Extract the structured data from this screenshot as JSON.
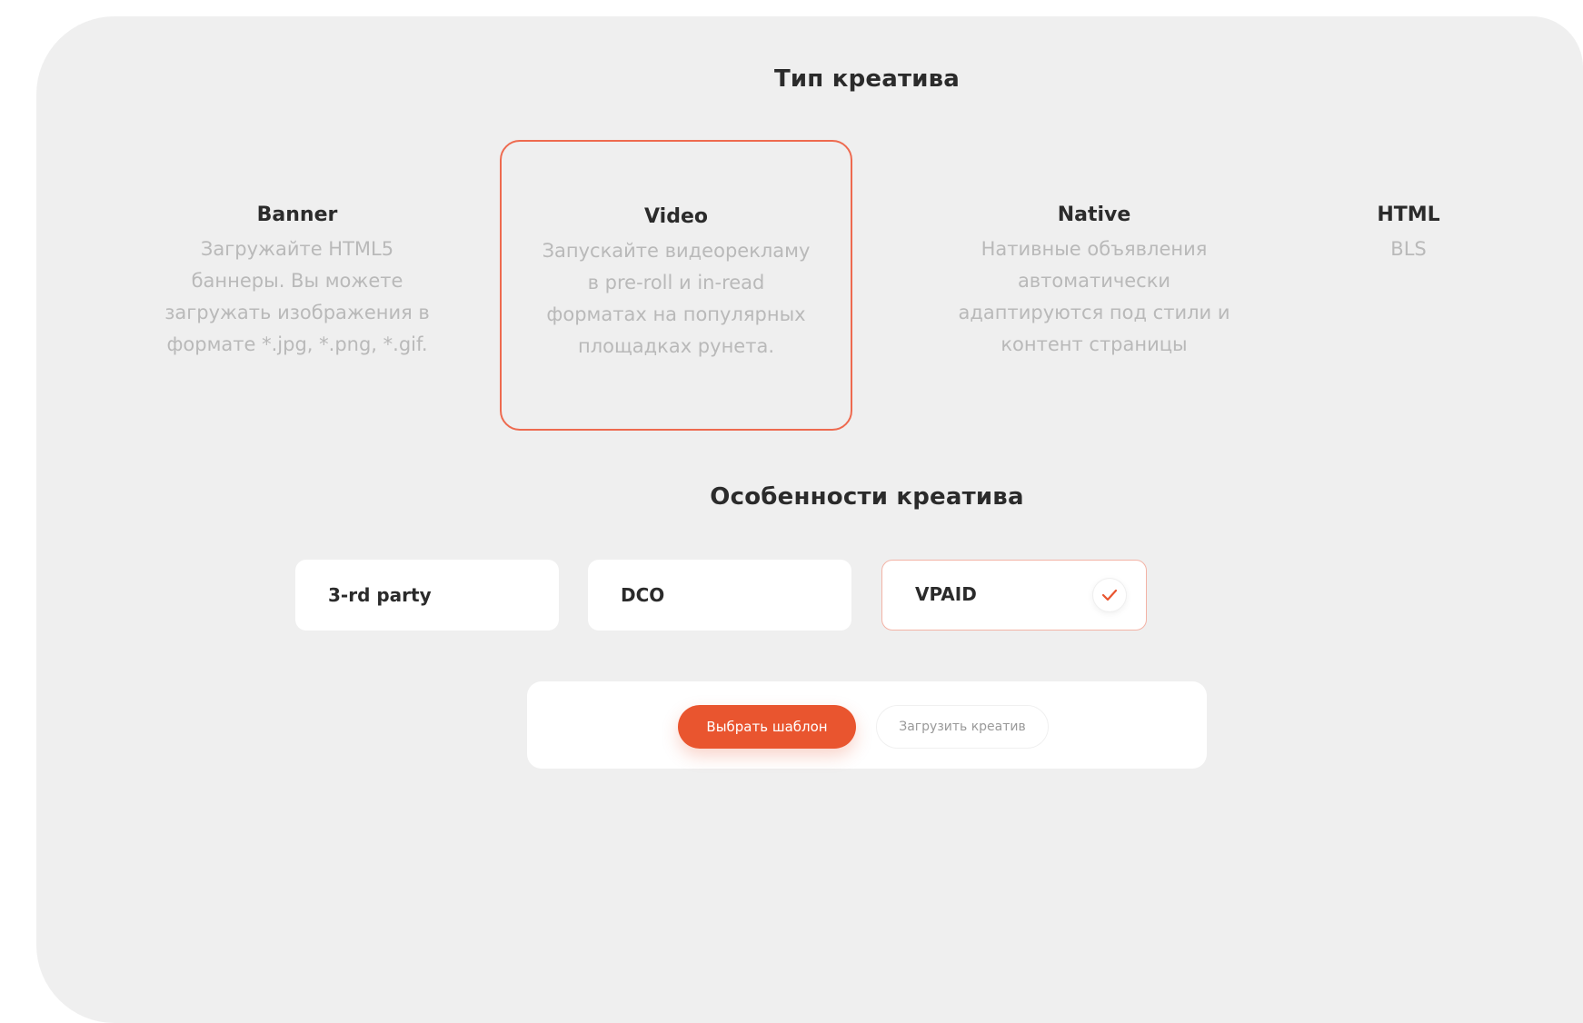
{
  "creative_type": {
    "title": "Тип креатива",
    "options": [
      {
        "name": "Banner",
        "description": "Загружайте HTML5 баннеры. Вы можете загружать изображения в формате *.jpg, *.png, *.gif."
      },
      {
        "name": "Video",
        "description": "Запускайте видеорекламу в pre-roll и in-read форматах на популярных площадках рунета."
      },
      {
        "name": "Native",
        "description": "Нативные объявления автоматически адаптируются под стили и контент страницы"
      },
      {
        "name": "HTML",
        "description": "BLS"
      }
    ],
    "selected": "Video"
  },
  "creative_features": {
    "title": "Особенности креатива",
    "options": [
      {
        "label": "3-rd party",
        "checked": false
      },
      {
        "label": "DCO",
        "checked": false
      },
      {
        "label": "VPAID",
        "checked": true
      }
    ]
  },
  "actions": {
    "primary_label": "Выбрать шаблон",
    "secondary_label": "Загрузить креатив"
  },
  "colors": {
    "accent": "#e9552f",
    "selected_border": "#ee6a4f",
    "panel_background": "#efefef",
    "muted_text": "#b9b9b9"
  },
  "icons": {
    "checkmark": "checkmark-icon"
  }
}
